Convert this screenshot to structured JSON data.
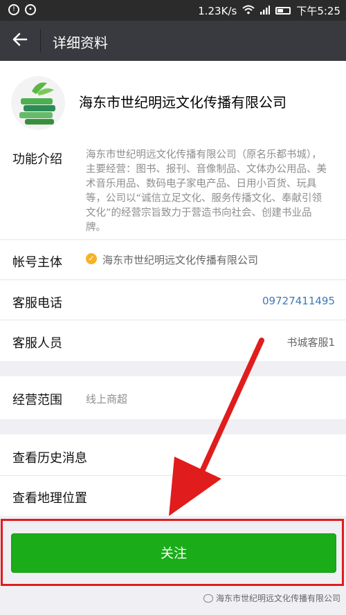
{
  "status_bar": {
    "network_speed": "1.23K/s",
    "time": "下午5:25"
  },
  "app_bar": {
    "title": "详细资料"
  },
  "account": {
    "name": "海东市世纪明远文化传播有限公司"
  },
  "details": {
    "intro_label": "功能介绍",
    "intro_text": "海东市世纪明远文化传播有限公司（原名乐都书城），主要经营：图书、报刊、音像制品、文体办公用品、美术音乐用品、数码电子家电产品、日用小百货、玩具等，公司以“诚信立足文化、服务传播文化、奉献引领文化”的经营宗旨致力于营造书向社会、创建书业品牌。",
    "entity_label": "帐号主体",
    "entity_value": "海东市世纪明远文化传播有限公司",
    "phone_label": "客服电话",
    "phone_value": "09727411495",
    "staff_label": "客服人员",
    "staff_value": "书城客服1"
  },
  "scope": {
    "label": "经营范围",
    "value": "线上商超"
  },
  "actions": {
    "history": "查看历史消息",
    "location": "查看地理位置"
  },
  "follow_button": {
    "label": "关注"
  },
  "watermark": {
    "text": "海东市世纪明远文化传播有限公司"
  },
  "colors": {
    "follow_green": "#1aad19",
    "annotation_red": "#e01c1c",
    "link_blue": "#3d7ab5"
  }
}
